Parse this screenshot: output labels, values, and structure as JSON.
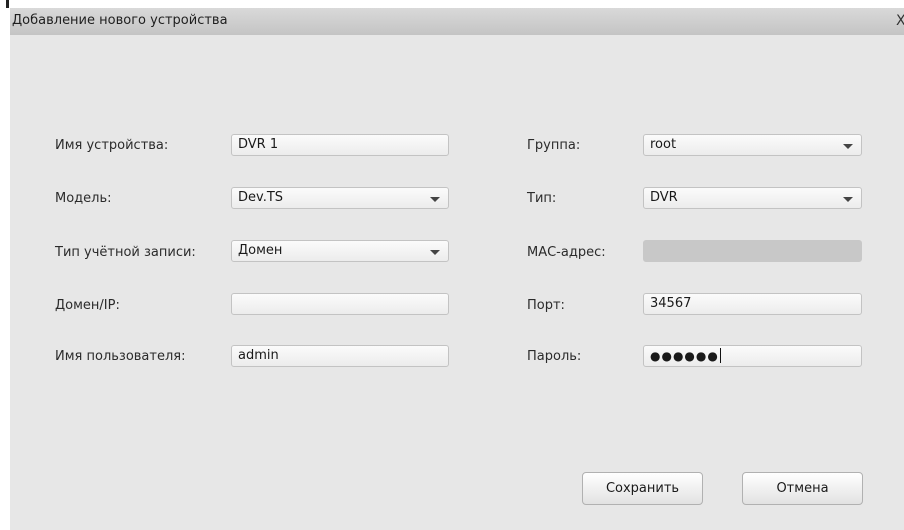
{
  "window": {
    "title": "Добавление нового устройства",
    "close_glyph": "X"
  },
  "form": {
    "device_name": {
      "label": "Имя устройства:",
      "value": "DVR 1"
    },
    "model": {
      "label": "Модель:",
      "value": "Dev.TS"
    },
    "account_type": {
      "label": "Тип учётной записи:",
      "value": "Домен"
    },
    "domain_ip": {
      "label": "Домен/IP:",
      "value": ""
    },
    "username": {
      "label": "Имя пользователя:",
      "value": "admin"
    },
    "group": {
      "label": "Группа:",
      "value": "root"
    },
    "type": {
      "label": "Тип:",
      "value": "DVR"
    },
    "mac": {
      "label": "МАС-адрес:",
      "value": ""
    },
    "port": {
      "label": "Порт:",
      "value": "34567"
    },
    "password": {
      "label": "Пароль:",
      "value": "●●●●●●"
    }
  },
  "buttons": {
    "save": "Сохранить",
    "cancel": "Отмена"
  },
  "icons": {
    "dropdown": "chevron-down-icon",
    "close": "close-icon"
  }
}
